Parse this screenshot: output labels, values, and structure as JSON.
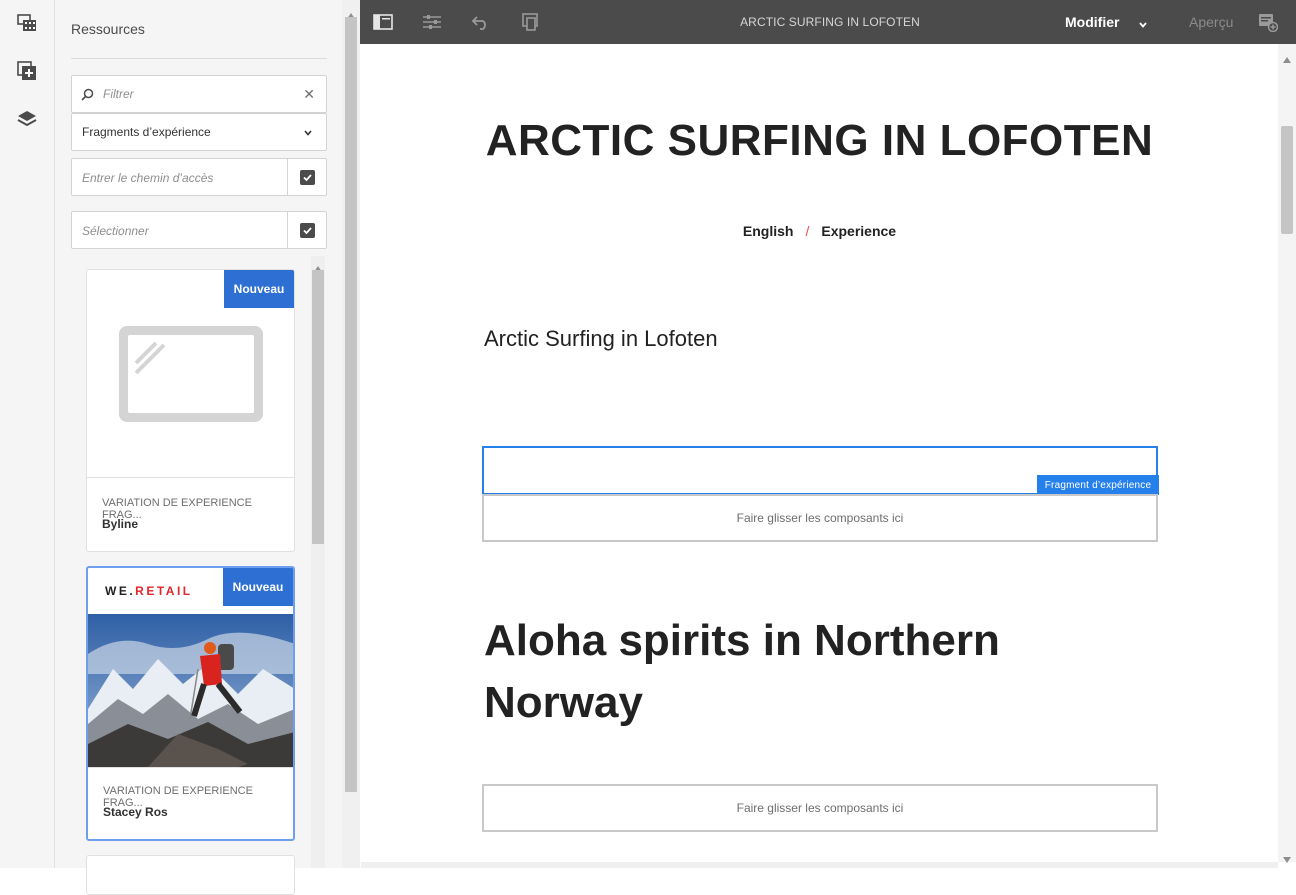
{
  "rail": {
    "items": [
      {
        "icon": "assets-filmstrip-icon"
      },
      {
        "icon": "components-add-icon"
      },
      {
        "icon": "layers-icon"
      }
    ]
  },
  "panel": {
    "title": "Ressources",
    "filter_placeholder": "Filtrer",
    "type_select_value": "Fragments d’expérience",
    "path_placeholder": "Entrer le chemin d’accès",
    "tags_placeholder": "Sélectionner",
    "cards": [
      {
        "badge": "Nouveau",
        "meta": "VARIATION DE EXPERIENCE FRAG...",
        "name": "Byline"
      },
      {
        "badge": "Nouveau",
        "logo_we": "WE.",
        "logo_retail": "RETAIL",
        "meta": "VARIATION DE EXPERIENCE FRAG...",
        "name": "Stacey Ros"
      }
    ]
  },
  "toolbar": {
    "page_title": "ARCTIC SURFING IN LOFOTEN",
    "mode_label": "Modifier",
    "preview_label": "Aperçu"
  },
  "page": {
    "title": "ARCTIC SURFING IN LOFOTEN",
    "breadcrumb": [
      "English",
      "/",
      "Experience"
    ],
    "subtitle": "Arctic Surfing in Lofoten",
    "xf_label": "Fragment d’expérience",
    "dropzone_label": "Faire glisser les composants ici",
    "heading2": "Aloha spirits in Northern Norway"
  },
  "colors": {
    "toolbar_bg": "#4b4b4b",
    "badge_blue": "#2d6fd3",
    "selection_blue": "#2680eb",
    "logo_red": "#e3262b"
  }
}
